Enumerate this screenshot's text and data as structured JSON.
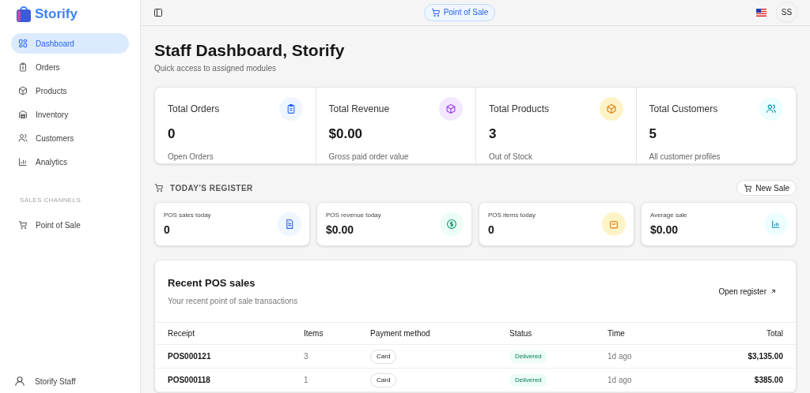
{
  "brand": "Storify",
  "sidebar": {
    "items": [
      {
        "label": "Dashboard",
        "selected": true
      },
      {
        "label": "Orders",
        "selected": false
      },
      {
        "label": "Products",
        "selected": false
      },
      {
        "label": "Inventory",
        "selected": false
      },
      {
        "label": "Customers",
        "selected": false
      },
      {
        "label": "Analytics",
        "selected": false
      }
    ],
    "section_title": "SALES CHANNELS",
    "channels": [
      {
        "label": "Point of Sale",
        "selected": false
      }
    ],
    "user": "Storify Staff"
  },
  "header": {
    "pos_button": "Point of Sale",
    "avatar": "SS"
  },
  "page": {
    "title": "Staff Dashboard, Storify",
    "subtitle": "Quick access to assigned modules"
  },
  "stats": [
    {
      "label": "Total Orders",
      "value": "0",
      "note": "Open Orders"
    },
    {
      "label": "Total Revenue",
      "value": "$0.00",
      "note": "Gross paid order value"
    },
    {
      "label": "Total Products",
      "value": "3",
      "note": "Out of Stock"
    },
    {
      "label": "Total Customers",
      "value": "5",
      "note": "All customer profiles"
    }
  ],
  "register": {
    "title": "TODAY'S REGISTER",
    "new_sale": "New Sale",
    "cards": [
      {
        "label": "POS sales today",
        "value": "0"
      },
      {
        "label": "POS revenue today",
        "value": "$0.00"
      },
      {
        "label": "POS items today",
        "value": "0"
      },
      {
        "label": "Average sale",
        "value": "$0.00"
      }
    ]
  },
  "recent": {
    "title": "Recent POS sales",
    "subtitle": "Your recent point of sale transactions",
    "link": "Open register",
    "table": {
      "columns": [
        "Receipt",
        "Items",
        "Payment method",
        "Status",
        "Time",
        "Total"
      ],
      "rows": [
        [
          "POS000121",
          "3",
          "Card",
          "Delivered",
          "1d ago",
          "$3,135.00"
        ],
        [
          "POS000118",
          "1",
          "Card",
          "Delivered",
          "1d ago",
          "$385.00"
        ]
      ]
    }
  }
}
